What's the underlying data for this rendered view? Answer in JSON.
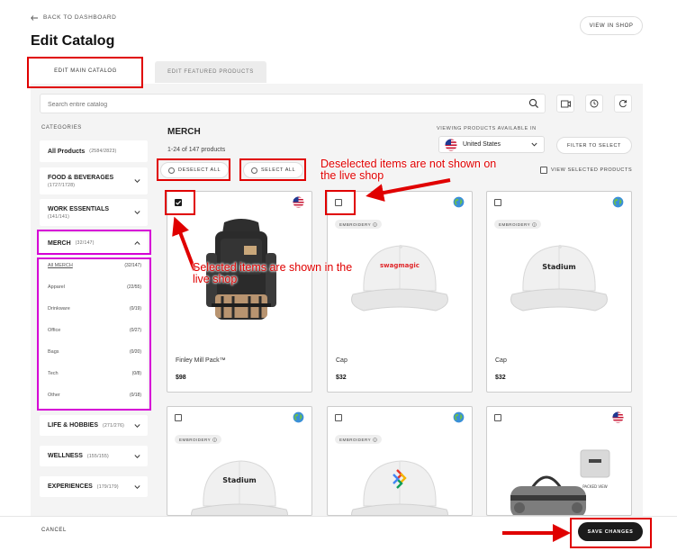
{
  "header": {
    "back_label": "BACK TO DASHBOARD",
    "title": "Edit Catalog",
    "view_in_shop": "VIEW IN SHOP"
  },
  "tabs": [
    {
      "label": "EDIT MAIN CATALOG",
      "active": true
    },
    {
      "label": "EDIT FEATURED PRODUCTS",
      "active": false
    }
  ],
  "search": {
    "placeholder": "Search entire catalog"
  },
  "sidebar": {
    "heading": "CATEGORIES",
    "categories": [
      {
        "label": "All Products",
        "count": "(2584/2823)"
      },
      {
        "label": "FOOD & BEVERAGES",
        "count": "(1727/1728)"
      },
      {
        "label": "WORK ESSENTIALS",
        "count": "(141/141)"
      },
      {
        "label": "MERCH",
        "count": "(32/147)"
      },
      {
        "label": "LIFE & HOBBIES",
        "count": "(271/276)"
      },
      {
        "label": "WELLNESS",
        "count": "(155/155)"
      },
      {
        "label": "EXPERIENCES",
        "count": "(179/179)"
      }
    ],
    "merch_subs": [
      {
        "label": "All MERCH",
        "count": "(32/147)"
      },
      {
        "label": "Apparel",
        "count": "(22/55)"
      },
      {
        "label": "Drinkware",
        "count": "(0/19)"
      },
      {
        "label": "Office",
        "count": "(0/27)"
      },
      {
        "label": "Bags",
        "count": "(0/20)"
      },
      {
        "label": "Tech",
        "count": "(0/8)"
      },
      {
        "label": "Other",
        "count": "(0/18)"
      }
    ]
  },
  "main": {
    "heading": "MERCH",
    "count_text": "1-24 of 147 products",
    "deselect_all": "DESELECT ALL",
    "select_all": "SELECT ALL",
    "viewing_label": "VIEWING PRODUCTS AVAILABLE IN",
    "country": "United States",
    "filter_label": "FILTER TO SELECT",
    "view_selected": "VIEW SELECTED PRODUCTS"
  },
  "products": [
    {
      "name": "Finley Mill Pack™",
      "price": "$98",
      "selected": true,
      "flag": "us-flag",
      "tag": ""
    },
    {
      "name": "Cap",
      "price": "$32",
      "selected": false,
      "flag": "globe",
      "tag": "EMBROIDERY",
      "print": "swagmagic"
    },
    {
      "name": "Cap",
      "price": "$32",
      "selected": false,
      "flag": "globe",
      "tag": "EMBROIDERY",
      "print": "Stadium"
    },
    {
      "name": "",
      "price": "",
      "selected": false,
      "flag": "globe",
      "tag": "EMBROIDERY",
      "print": "Stadium"
    },
    {
      "name": "",
      "price": "",
      "selected": false,
      "flag": "globe",
      "tag": "EMBROIDERY"
    },
    {
      "name": "",
      "price": "",
      "selected": false,
      "flag": "us-flag",
      "tag": "",
      "print": "PACKED VIEW"
    }
  ],
  "footer": {
    "cancel": "CANCEL",
    "save": "SAVE CHANGES"
  },
  "annotations": {
    "deselected_note": "Deselected items are not shown on the live shop",
    "selected_note": "Selected items are shown in the live shop"
  },
  "colors": {
    "annotation_red": "#e00000",
    "annotation_magenta": "#d600d6",
    "primary_button": "#1b1b1b"
  }
}
